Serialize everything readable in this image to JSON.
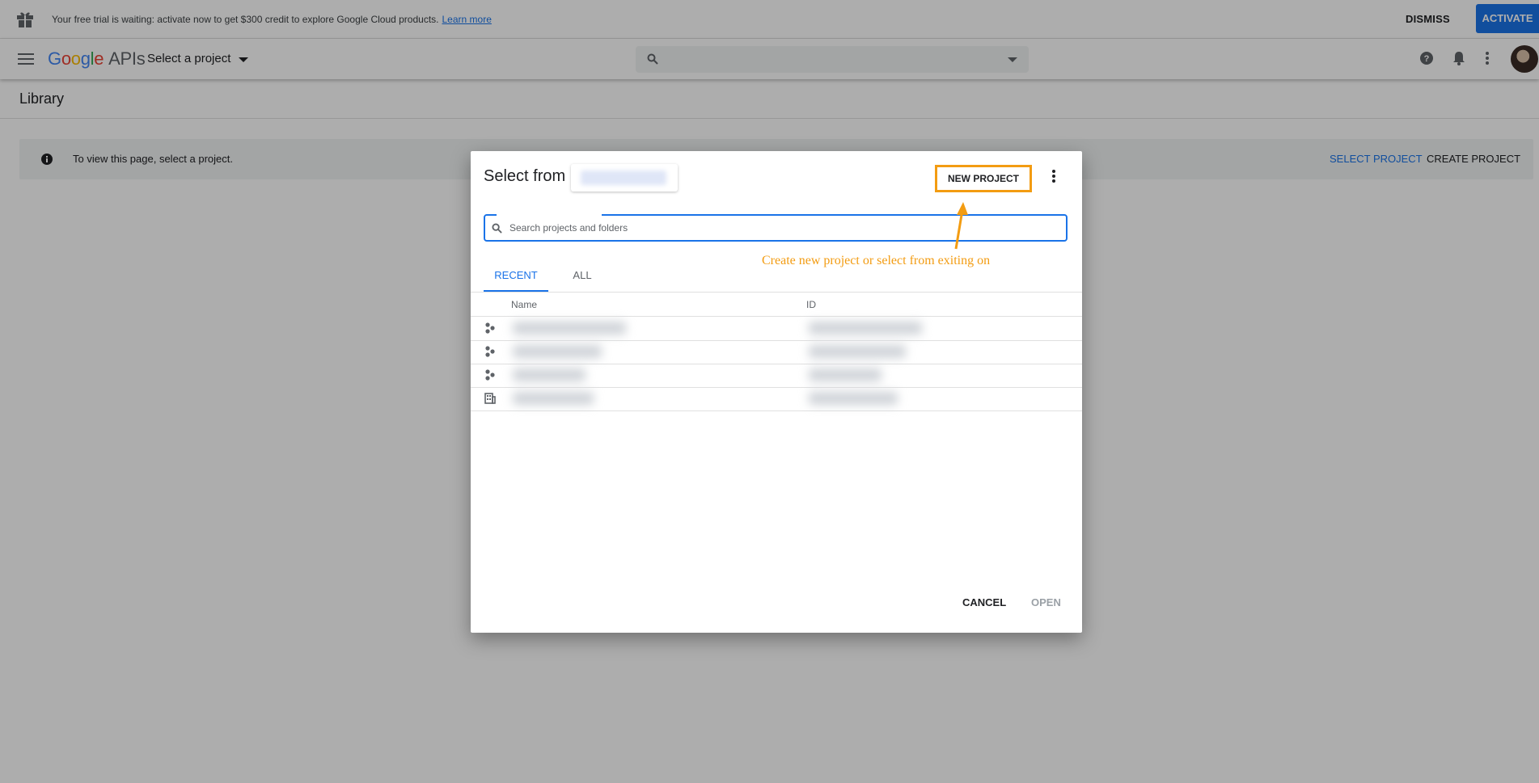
{
  "banner": {
    "message": "Your free trial is waiting: activate now to get $300 credit to explore Google Cloud products.",
    "learn_more": "Learn more",
    "dismiss_label": "DISMISS",
    "activate_label": "ACTIVATE",
    "activate_color": "#1a73e8"
  },
  "header": {
    "logo_google": [
      "G",
      "o",
      "o",
      "g",
      "l",
      "e"
    ],
    "logo_apis": "APIs",
    "project_selector": "Select a project",
    "icons": [
      "menu-icon",
      "search-icon",
      "help-icon",
      "notifications-icon",
      "more-vert-icon"
    ]
  },
  "page": {
    "title": "Library",
    "info_message": "To view this page, select a project.",
    "select_project": "SELECT PROJECT",
    "create_project": "CREATE PROJECT"
  },
  "dialog": {
    "title": "Select from",
    "new_project": "NEW PROJECT",
    "search_placeholder": "Search projects and folders",
    "tabs": [
      "RECENT",
      "ALL"
    ],
    "active_tab": "RECENT",
    "columns": [
      "Name",
      "ID"
    ],
    "rows": [
      {
        "type": "project",
        "icon": "project-icon"
      },
      {
        "type": "project",
        "icon": "project-icon"
      },
      {
        "type": "project",
        "icon": "project-icon"
      },
      {
        "type": "organization",
        "icon": "organization-icon"
      }
    ],
    "cancel": "CANCEL",
    "open": "OPEN"
  },
  "annotation": {
    "text": "Create new project or select from exiting on",
    "color": "#f39c12"
  }
}
